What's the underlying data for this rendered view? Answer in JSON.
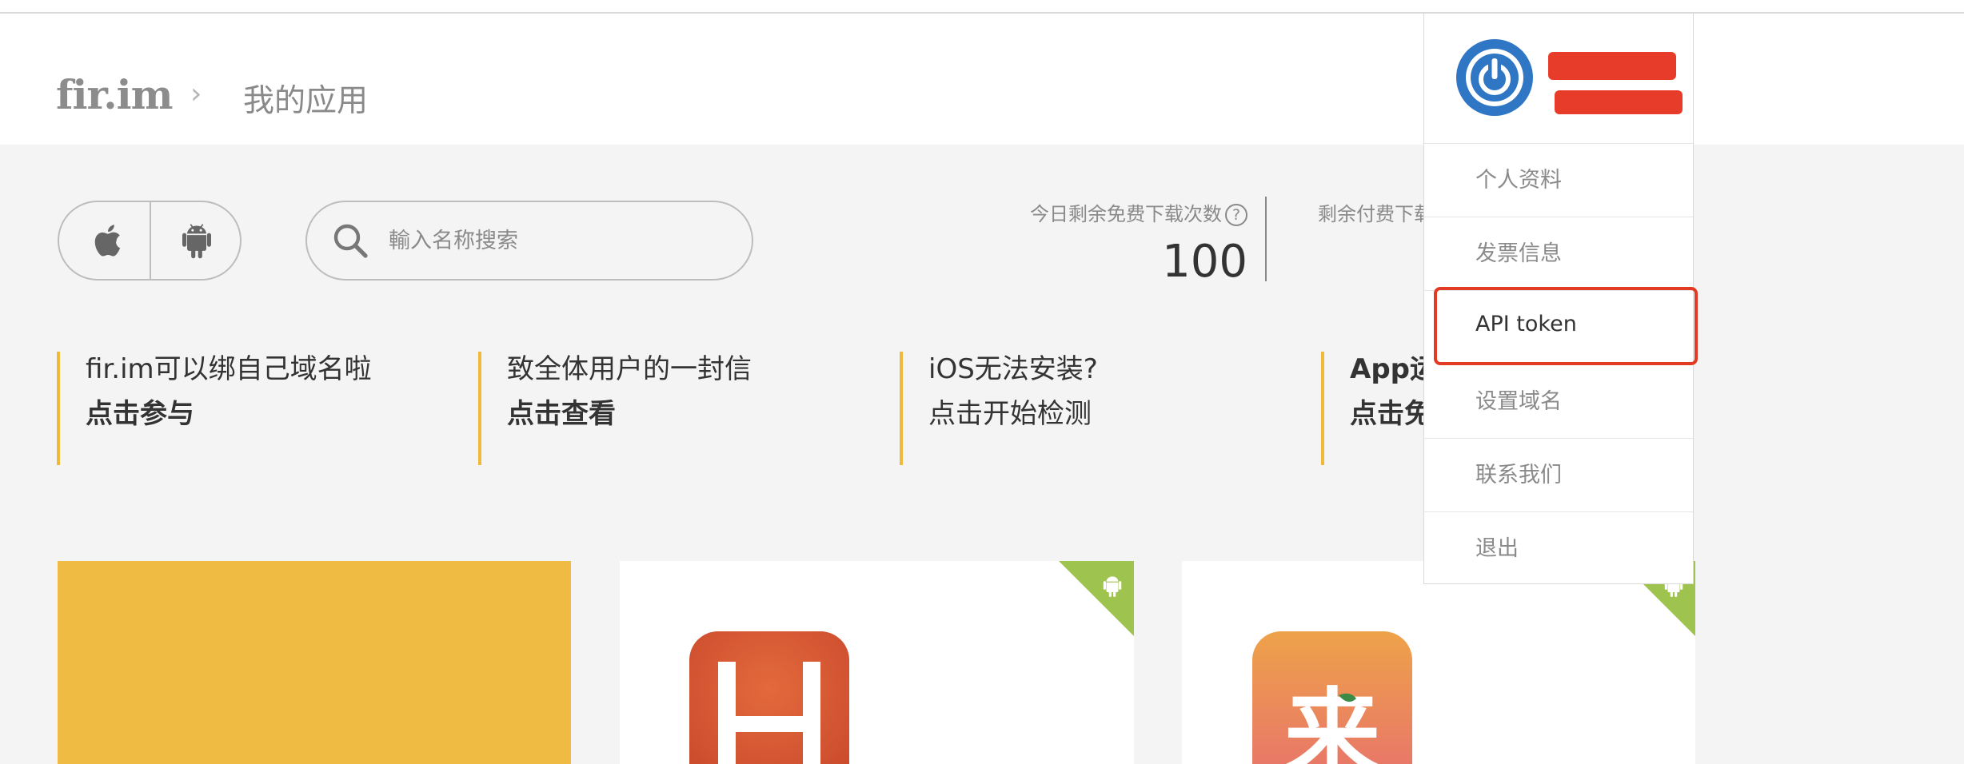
{
  "header": {
    "logo": "fir.im",
    "breadcrumb_separator": "›",
    "breadcrumb_current": "我的应用"
  },
  "filters": {
    "ios_icon": "apple-icon",
    "android_icon": "android-icon"
  },
  "search": {
    "placeholder": "輸入名称搜索",
    "value": "",
    "icon": "search-icon"
  },
  "stats": {
    "free_label": "今日剩余免费下载次数",
    "free_help": "?",
    "free_value": "100",
    "paid_label": "剩余付费下载"
  },
  "notices": [
    {
      "title": "fir.im可以绑自己域名啦",
      "action": "点击参与"
    },
    {
      "title": "致全体用户的一封信",
      "action": "点击查看"
    },
    {
      "title": "iOS无法安装?",
      "action": "点击开始检测"
    },
    {
      "title": "App运",
      "action": "点击免"
    }
  ],
  "user_menu": {
    "avatar_icon": "power-icon",
    "items": [
      {
        "label": "个人资料"
      },
      {
        "label": "发票信息"
      },
      {
        "label": "API token",
        "highlighted": true
      },
      {
        "label": "设置域名"
      },
      {
        "label": "联系我们"
      },
      {
        "label": "退出"
      }
    ]
  },
  "apps": [
    {
      "platform": "other",
      "icon_letter": ""
    },
    {
      "platform": "android",
      "icon_letter": "H"
    },
    {
      "platform": "android",
      "icon_letter": "来"
    }
  ],
  "colors": {
    "accent_yellow": "#f1b93a",
    "android_green": "#9fc34f",
    "highlight_red": "#e23a23",
    "avatar_blue": "#2f77c5"
  }
}
